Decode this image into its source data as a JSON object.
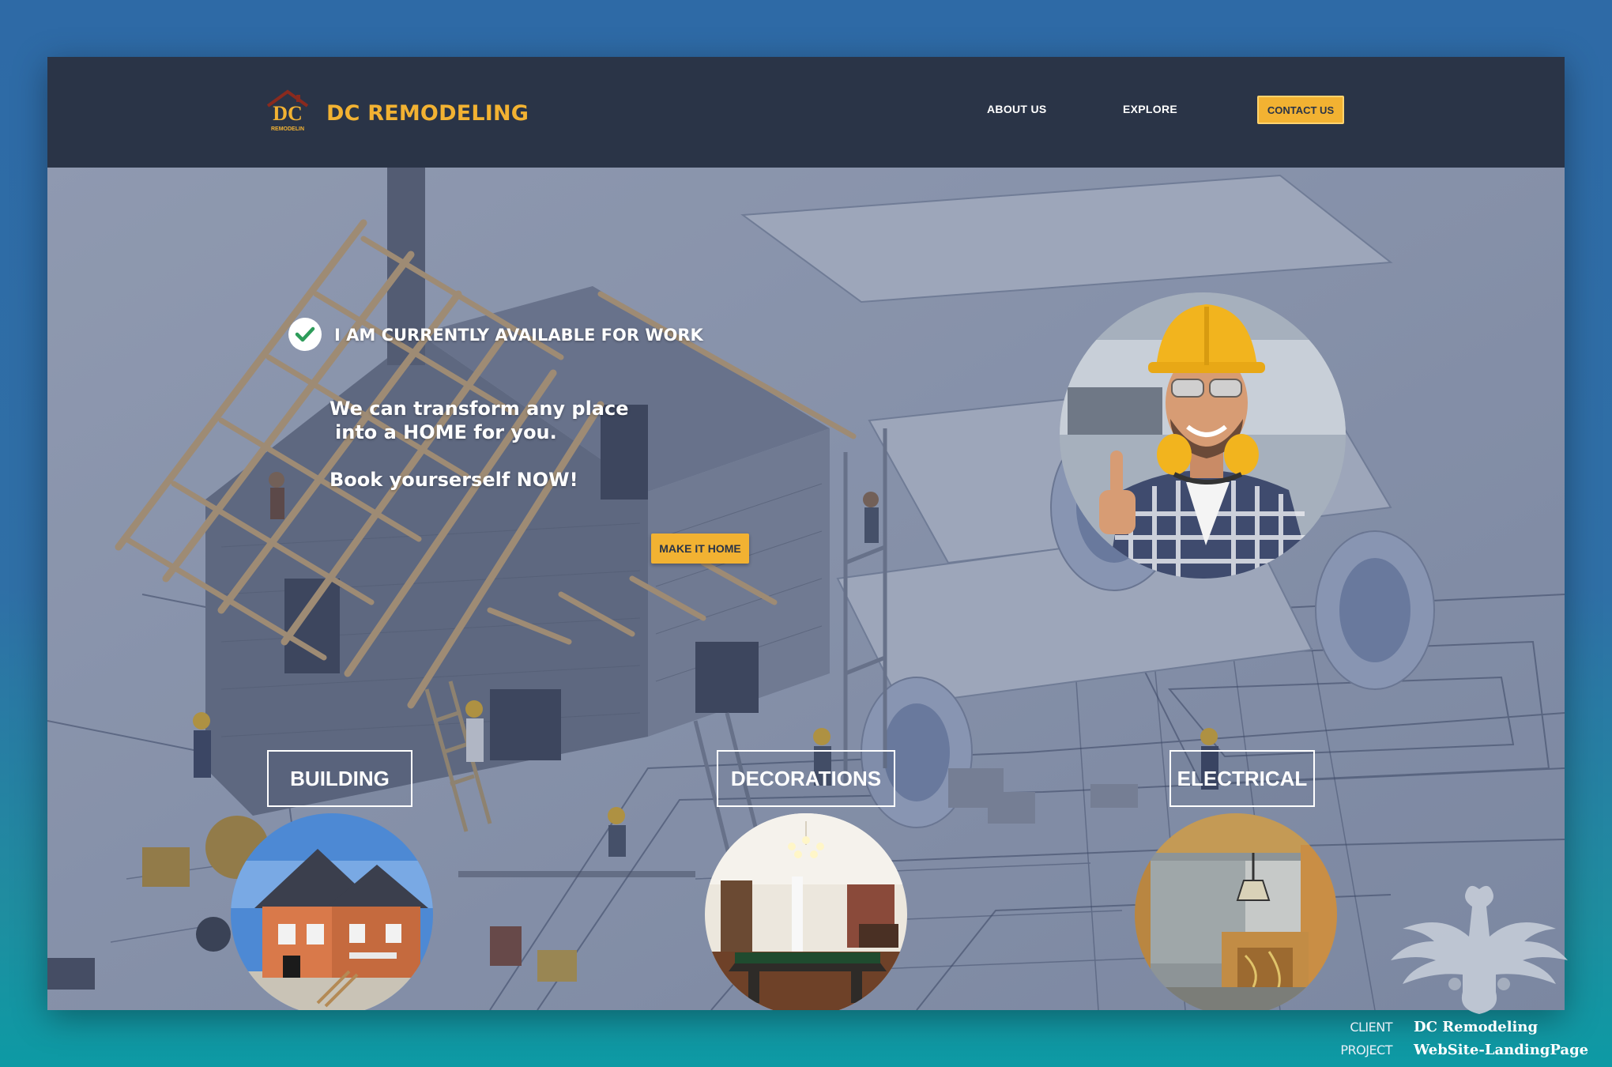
{
  "brand": {
    "name": "DC REMODELING",
    "logo_text": "DC",
    "logo_subtext": "REMODELIN"
  },
  "nav": {
    "about_label": "ABOUT US",
    "explore_label": "EXPLORE",
    "contact_label": "CONTACT US"
  },
  "hero": {
    "availability": "I AM CURRENTLY AVAILABLE FOR WORK",
    "tagline_line1": "We can transform any place",
    "tagline_line2": "into a HOME for you.",
    "tagline_line3": "Book yourserself NOW!",
    "cta_label": "MAKE IT HOME"
  },
  "categories": [
    {
      "label": "BUILDING"
    },
    {
      "label": "DECORATIONS"
    },
    {
      "label": "ELECTRICAL"
    }
  ],
  "credits": {
    "client_key": "CLIENT",
    "client_value": "DC Remodeling",
    "project_key": "PROJECT",
    "project_value": "WebSite-LandingPage"
  },
  "colors": {
    "accent": "#f2b232",
    "nav_bg": "#2a3447",
    "page_bg": "#2e6aa6"
  },
  "icons": [
    "check-icon",
    "logo-house-icon",
    "eagle-watermark-icon"
  ]
}
